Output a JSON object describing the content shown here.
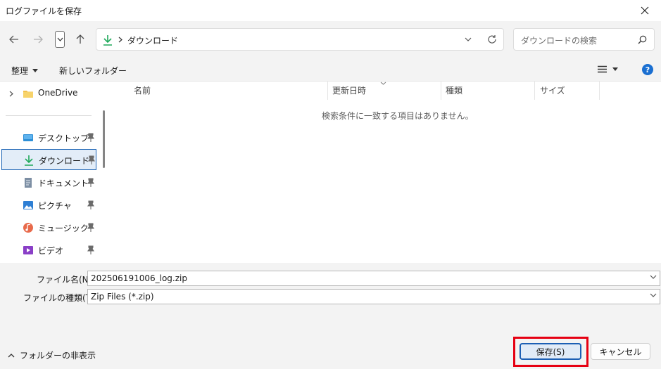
{
  "window": {
    "title": "ログファイルを保存"
  },
  "nav": {
    "address": {
      "current": "ダウンロード"
    },
    "search_placeholder": "ダウンロードの検索"
  },
  "toolbar": {
    "organize": "整理",
    "new_folder": "新しいフォルダー"
  },
  "sidebar": {
    "items": [
      {
        "label": "OneDrive",
        "icon": "folder-icon"
      },
      {
        "label": "デスクトップ",
        "icon": "desktop-icon"
      },
      {
        "label": "ダウンロード",
        "icon": "download-icon"
      },
      {
        "label": "ドキュメント",
        "icon": "document-icon"
      },
      {
        "label": "ピクチャ",
        "icon": "picture-icon"
      },
      {
        "label": "ミュージック",
        "icon": "music-icon"
      },
      {
        "label": "ビデオ",
        "icon": "video-icon"
      }
    ]
  },
  "list": {
    "columns": [
      "名前",
      "更新日時",
      "種類",
      "サイズ"
    ],
    "empty_message": "検索条件に一致する項目はありません。"
  },
  "footer": {
    "filename_label": "ファイル名(N):",
    "filename_value": "202506191006_log.zip",
    "filetype_label": "ファイルの種類(T):",
    "filetype_value": "Zip Files (*.zip)",
    "hide_folders": "フォルダーの非表示",
    "save": "保存(S)",
    "cancel": "キャンセル"
  },
  "colors": {
    "accent": "#1c5fb4",
    "highlight": "#e60012",
    "download_green": "#1fa85a"
  }
}
